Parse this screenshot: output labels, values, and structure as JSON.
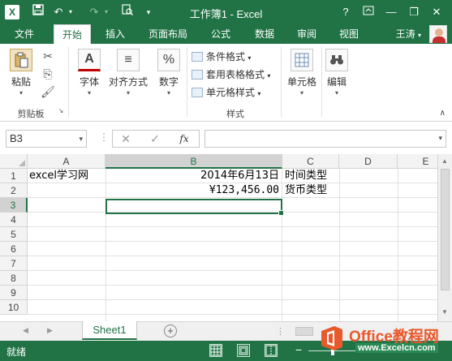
{
  "app": {
    "window_title": "工作簿1 - Excel",
    "logo": "X",
    "help": "?",
    "user": "王涛"
  },
  "qat": {
    "save_icon": "save-icon",
    "undo_icon": "undo-icon",
    "redo_icon": "redo-icon",
    "preview_icon": "print-preview-icon"
  },
  "tabs": [
    "文件",
    "开始",
    "插入",
    "页面布局",
    "公式",
    "数据",
    "审阅",
    "视图"
  ],
  "active_tab": "开始",
  "ribbon": {
    "clipboard": {
      "paste": "粘贴",
      "group": "剪贴板"
    },
    "font": "字体",
    "alignment": "对齐方式",
    "number": "数字",
    "styles": {
      "conditional": "条件格式",
      "table": "套用表格格式",
      "cell_styles": "单元格样式",
      "group": "样式"
    },
    "cells": "单元格",
    "editing": "编辑"
  },
  "formula_bar": {
    "name_box": "B3",
    "fx": "fx",
    "cancel": "✕",
    "enter": "✓",
    "value": ""
  },
  "grid": {
    "columns": [
      "A",
      "B",
      "C",
      "D",
      "E"
    ],
    "rows": [
      "1",
      "2",
      "3",
      "4",
      "5",
      "6",
      "7",
      "8",
      "9",
      "10"
    ],
    "cells": {
      "A1": "excel学习网",
      "B1": "2014年6月13日",
      "C1": "时间类型",
      "B2": "¥123,456.00",
      "C2": "货币类型"
    },
    "selected_cell": "B3"
  },
  "sheets": [
    "Sheet1"
  ],
  "status": {
    "ready": "就绪"
  },
  "watermark": {
    "line1_latin": "Office",
    "line1_zh": "教程网",
    "line2": "www.Excelcn.com"
  },
  "colors": {
    "excel_green": "#217346",
    "watermark_orange": "#e8592b"
  }
}
